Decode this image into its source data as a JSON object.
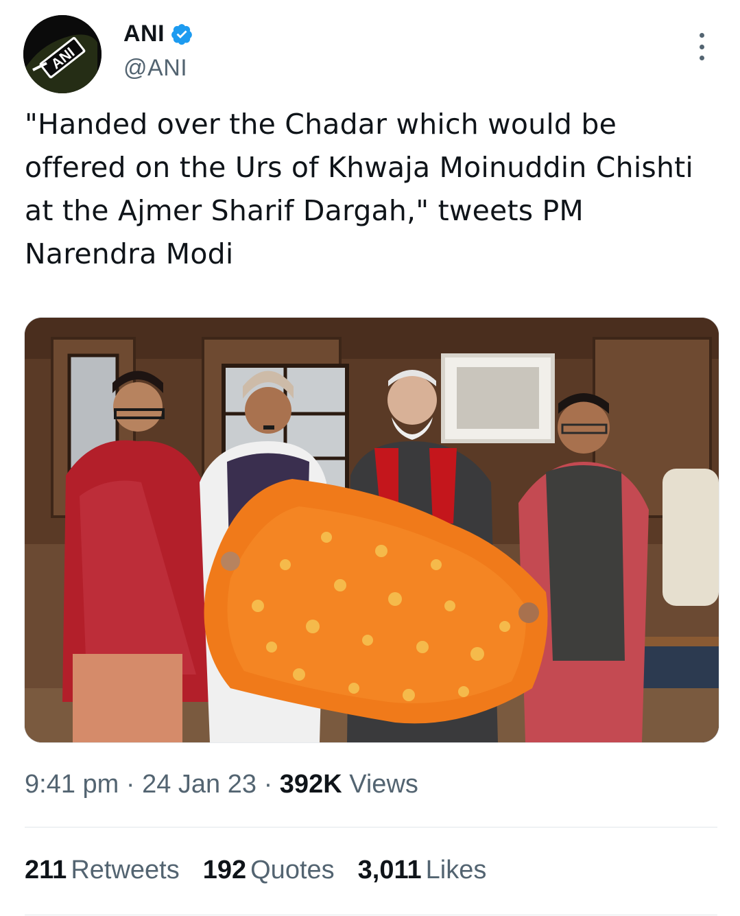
{
  "author": {
    "name": "ANI",
    "handle": "@ANI",
    "avatar_logo_text": "ANI",
    "verified": true,
    "verified_color": "#1d9bf0"
  },
  "tweet": {
    "text": "\"Handed over the Chadar which would be offered on the Urs of Khwaja Moinuddin Chishti at the Ajmer Sharif Dargah,\" tweets PM Narendra Modi"
  },
  "meta": {
    "time": "9:41 pm",
    "separator": "·",
    "date": "24 Jan 23",
    "views_count": "392K",
    "views_label": "Views"
  },
  "stats": {
    "retweets_count": "211",
    "retweets_label": "Retweets",
    "quotes_count": "192",
    "quotes_label": "Quotes",
    "likes_count": "3,011",
    "likes_label": "Likes"
  },
  "icons": {
    "more": "more-options-icon",
    "verified": "verified-badge-icon"
  }
}
